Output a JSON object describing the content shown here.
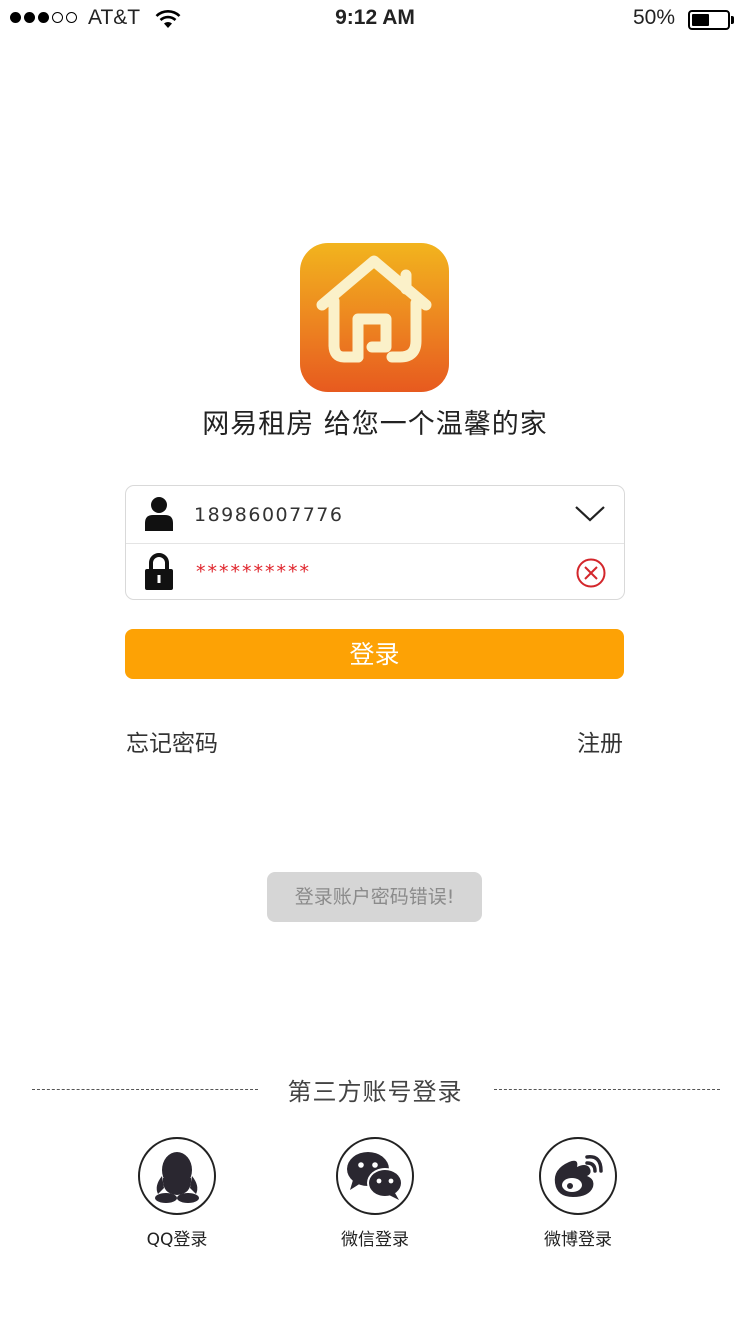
{
  "status_bar": {
    "signal_bars_filled": 3,
    "signal_bars_total": 5,
    "carrier": "AT&T",
    "time": "9:12 AM",
    "battery_percent": "50%",
    "battery_level": 0.5
  },
  "brand": {
    "tagline": "网易租房 给您一个温馨的家",
    "logo_icon": "house-icon"
  },
  "form": {
    "username_value": "18986007776",
    "password_value": "**********",
    "username_icon": "user-icon",
    "password_icon": "lock-icon",
    "dropdown_icon": "chevron-down-icon",
    "clear_icon": "clear-circle-icon"
  },
  "actions": {
    "login_label": "登录",
    "forgot_password": "忘记密码",
    "register": "注册"
  },
  "toast": {
    "message": "登录账户密码错误!"
  },
  "third_party": {
    "title": "第三方账号登录",
    "options": [
      {
        "label": "QQ登录",
        "icon": "qq-icon"
      },
      {
        "label": "微信登录",
        "icon": "wechat-icon"
      },
      {
        "label": "微博登录",
        "icon": "weibo-icon"
      }
    ]
  },
  "colors": {
    "accent": "#fda205",
    "error": "#e0262d",
    "toast_bg": "#d6d6d6",
    "logo_top": "#f2b41e",
    "logo_bottom": "#e75a1f"
  }
}
